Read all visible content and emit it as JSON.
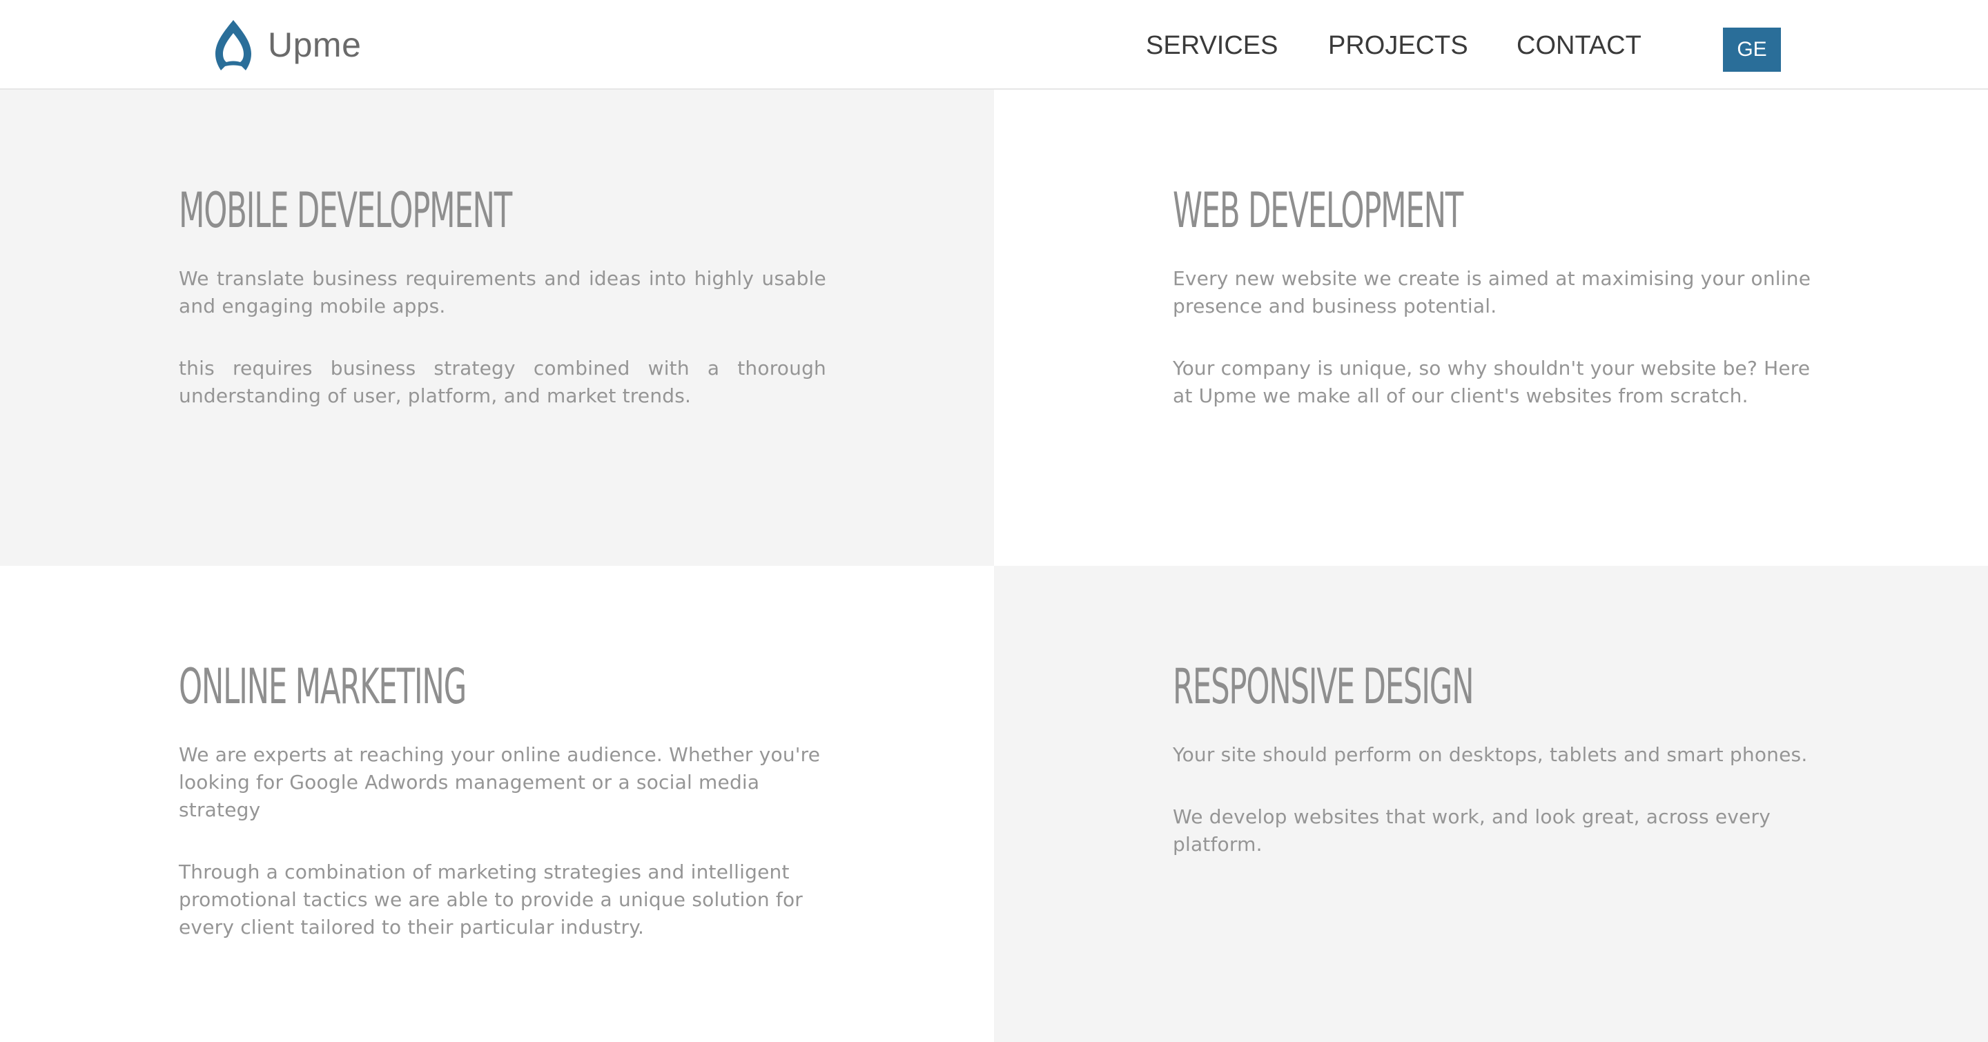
{
  "header": {
    "logo_text": "Upme",
    "logo_icon": "drop-icon",
    "nav": [
      {
        "label": "SERVICES"
      },
      {
        "label": "PROJECTS"
      },
      {
        "label": "CONTACT"
      }
    ],
    "lang_button": "GE",
    "accent_color": "#2a6e99"
  },
  "services": [
    {
      "title": "MOBILE DEVELOPMENT",
      "paragraphs": [
        "We translate business requirements and ideas into highly usable and engaging mobile apps.",
        "this requires business strategy combined with a thorough understanding of user, platform, and market trends."
      ]
    },
    {
      "title": "WEB DEVELOPMENT",
      "paragraphs": [
        "Every new website we create is aimed at maximising your online presence and business potential.",
        "Your company is unique, so why shouldn't your website be? Here at Upme we make all of our client's websites from scratch."
      ]
    },
    {
      "title": "ONLINE MARKETING",
      "paragraphs": [
        "We are experts at reaching your online audience. Whether you're looking for Google Adwords management or a social media strategy",
        "Through a combination of marketing strategies and intelligent promotional tactics we are able to provide a unique solution for every client tailored to their particular industry."
      ]
    },
    {
      "title": "RESPONSIVE DESIGN",
      "paragraphs": [
        "Your site should perform on desktops, tablets and smart phones.",
        "We develop websites that work, and look great, across every platform."
      ]
    }
  ]
}
